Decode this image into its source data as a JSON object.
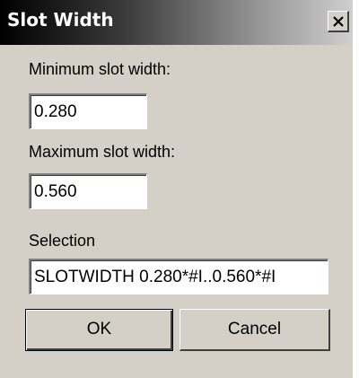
{
  "window": {
    "title": "Slot Width",
    "close_icon": "close-icon"
  },
  "form": {
    "min_label": "Minimum slot width:",
    "min_value": "0.280",
    "max_label": "Maximum slot width:",
    "max_value": "0.560",
    "selection_label": "Selection",
    "selection_value": "SLOTWIDTH 0.280*#I..0.560*#I"
  },
  "buttons": {
    "ok_label": "OK",
    "cancel_label": "Cancel"
  },
  "colors": {
    "dialog_background": "#d4d0c8",
    "titlebar_start": "#000000",
    "titlebar_end": "#cfcfcf",
    "field_background": "#ffffff"
  }
}
